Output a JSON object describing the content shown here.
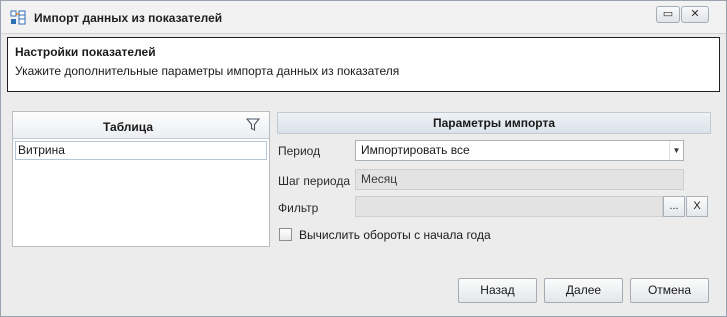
{
  "window": {
    "title": "Импорт данных из показателей",
    "restore_glyph": "▭",
    "close_glyph": "✕"
  },
  "header": {
    "title": "Настройки показателей",
    "subtitle": "Укажите дополнительные параметры импорта данных из показателя"
  },
  "table": {
    "column_title": "Таблица",
    "rows": [
      "Витрина"
    ]
  },
  "params": {
    "title": "Параметры импорта",
    "period_label": "Период",
    "period_value": "Импортировать все",
    "step_label": "Шаг периода",
    "step_value": "Месяц",
    "filter_label": "Фильтр",
    "filter_value": "",
    "filter_browse": "...",
    "filter_clear": "X",
    "cumulative_label": "Вычислить обороты с начала года",
    "cumulative_checked": false
  },
  "buttons": {
    "back": "Назад",
    "next": "Далее",
    "cancel": "Отмена"
  },
  "icons": {
    "app": "import-indicators-icon",
    "filter": "funnel-icon",
    "dropdown": "chevron-down-icon"
  }
}
